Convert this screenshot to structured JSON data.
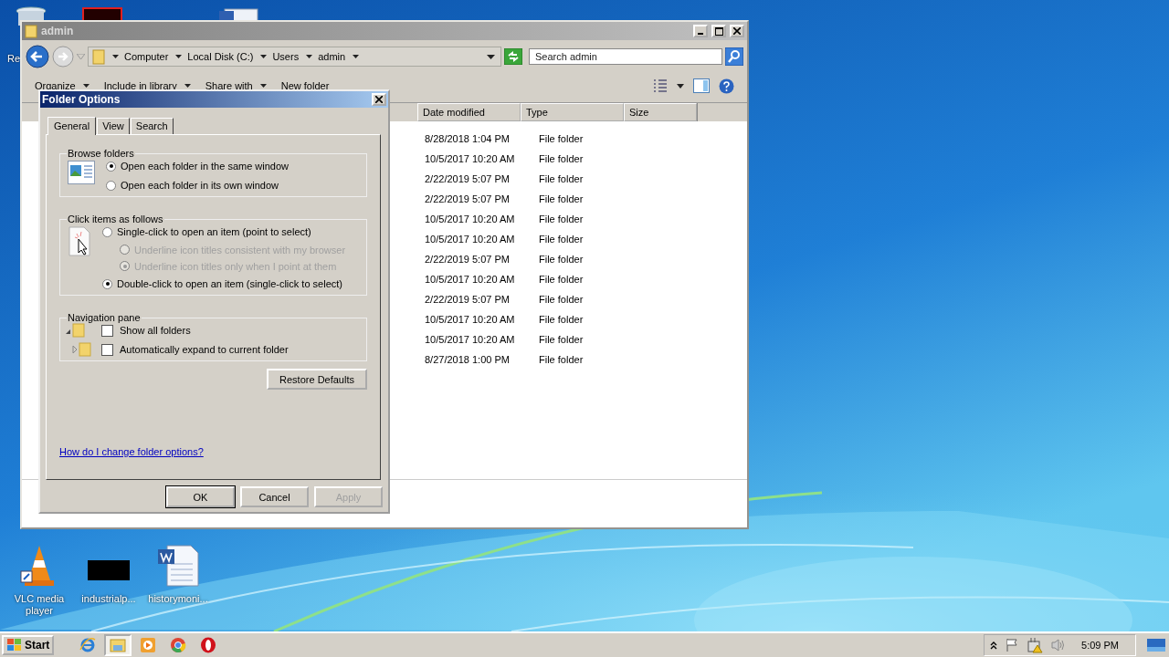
{
  "desktop": {
    "top_icons": [
      {
        "kind": "recycle",
        "label": "Re"
      },
      {
        "kind": "app"
      },
      {
        "kind": "doc"
      }
    ],
    "icons": [
      {
        "kind": "vlc",
        "label": "VLC media player"
      },
      {
        "kind": "blank",
        "label": "industrialp..."
      },
      {
        "kind": "word",
        "label": "historymoni..."
      }
    ]
  },
  "explorer": {
    "title": "admin",
    "breadcrumb": [
      "Computer",
      "Local Disk (C:)",
      "Users",
      "admin"
    ],
    "search": {
      "placeholder": "Search admin"
    },
    "toolbar": [
      "Organize",
      "Include in library",
      "Share with",
      "New folder"
    ],
    "columns": [
      "Date modified",
      "Type",
      "Size"
    ],
    "rows": [
      {
        "date": "8/28/2018 1:04 PM",
        "type": "File folder"
      },
      {
        "date": "10/5/2017 10:20 AM",
        "type": "File folder"
      },
      {
        "date": "2/22/2019 5:07 PM",
        "type": "File folder"
      },
      {
        "date": "2/22/2019 5:07 PM",
        "type": "File folder"
      },
      {
        "date": "10/5/2017 10:20 AM",
        "type": "File folder"
      },
      {
        "date": "10/5/2017 10:20 AM",
        "type": "File folder"
      },
      {
        "date": "2/22/2019 5:07 PM",
        "type": "File folder"
      },
      {
        "date": "10/5/2017 10:20 AM",
        "type": "File folder"
      },
      {
        "date": "2/22/2019 5:07 PM",
        "type": "File folder"
      },
      {
        "date": "10/5/2017 10:20 AM",
        "type": "File folder"
      },
      {
        "date": "10/5/2017 10:20 AM",
        "type": "File folder"
      },
      {
        "date": "8/27/2018 1:00 PM",
        "type": "File folder"
      }
    ]
  },
  "dialog": {
    "title": "Folder Options",
    "tabs": [
      {
        "label": "General",
        "selected": true
      },
      {
        "label": "View",
        "selected": false
      },
      {
        "label": "Search",
        "selected": false
      }
    ],
    "groups": [
      {
        "kind": "browse",
        "title": "Browse folders",
        "options": [
          {
            "label": "Open each folder in the same window",
            "selected": true,
            "disabled": false
          },
          {
            "label": "Open each folder in its own window",
            "selected": false,
            "disabled": false
          }
        ]
      },
      {
        "kind": "click",
        "title": "Click items as follows",
        "options": [
          {
            "label": "Single-click to open an item (point to select)",
            "selected": false,
            "disabled": false,
            "children": [
              {
                "label": "Underline icon titles consistent with my browser",
                "selected": false,
                "disabled": true
              },
              {
                "label": "Underline icon titles only when I point at them",
                "selected": true,
                "disabled": true
              }
            ]
          },
          {
            "label": "Double-click to open an item (single-click to select)",
            "selected": true,
            "disabled": false
          }
        ]
      },
      {
        "kind": "nav",
        "title": "Navigation pane",
        "checkboxes": [
          {
            "label": "Show all folders",
            "checked": false,
            "expanded": true
          },
          {
            "label": "Automatically expand to current folder",
            "checked": false,
            "expanded": false
          }
        ]
      }
    ],
    "restore": "Restore Defaults",
    "link": "How do I change folder options?",
    "buttons": [
      {
        "label": "OK",
        "default": true,
        "disabled": false
      },
      {
        "label": "Cancel",
        "default": false,
        "disabled": false
      },
      {
        "label": "Apply",
        "default": false,
        "disabled": true
      }
    ]
  },
  "taskbar": {
    "start": "Start",
    "apps": [
      {
        "kind": "ie",
        "selected": false
      },
      {
        "kind": "explorer",
        "selected": true
      },
      {
        "kind": "media",
        "selected": false
      },
      {
        "kind": "chrome",
        "selected": false
      },
      {
        "kind": "opera",
        "selected": false
      }
    ],
    "clock": "5:09 PM"
  }
}
